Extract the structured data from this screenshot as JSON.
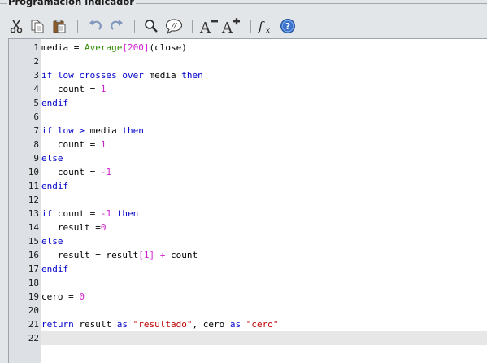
{
  "window": {
    "title": "Programación indicador"
  },
  "toolbar": {
    "buttons": [
      {
        "name": "cut-button",
        "icon": "scissors-icon"
      },
      {
        "name": "copy-button",
        "icon": "copy-icon"
      },
      {
        "name": "paste-button",
        "icon": "clipboard-icon"
      },
      {
        "name": "undo-button",
        "icon": "undo-icon"
      },
      {
        "name": "redo-button",
        "icon": "redo-icon"
      },
      {
        "name": "find-button",
        "icon": "magnifier-icon"
      },
      {
        "name": "comment-button",
        "icon": "comment-icon",
        "label": "//"
      },
      {
        "name": "decrease-font-button",
        "icon": "font-decrease-icon",
        "label": "A"
      },
      {
        "name": "increase-font-button",
        "icon": "font-increase-icon",
        "label": "A"
      },
      {
        "name": "insert-function-button",
        "icon": "function-icon",
        "label": "fx"
      },
      {
        "name": "help-button",
        "icon": "help-icon",
        "label": "?"
      }
    ]
  },
  "editor": {
    "current_line": 22,
    "lines": [
      {
        "n": "1",
        "tokens": [
          [
            "p",
            "media = "
          ],
          [
            "f",
            "Average"
          ],
          [
            "n",
            "[200]"
          ],
          [
            "p",
            "(close)"
          ]
        ]
      },
      {
        "n": "2",
        "tokens": []
      },
      {
        "n": "3",
        "tokens": [
          [
            "k",
            "if low crosses over"
          ],
          [
            "p",
            " media "
          ],
          [
            "k",
            "then"
          ]
        ]
      },
      {
        "n": "4",
        "tokens": [
          [
            "p",
            "   count = "
          ],
          [
            "n",
            "1"
          ]
        ]
      },
      {
        "n": "5",
        "tokens": [
          [
            "k",
            "endif"
          ]
        ]
      },
      {
        "n": "6",
        "tokens": []
      },
      {
        "n": "7",
        "tokens": [
          [
            "k",
            "if low > "
          ],
          [
            "p",
            "media "
          ],
          [
            "k",
            "then"
          ]
        ]
      },
      {
        "n": "8",
        "tokens": [
          [
            "p",
            "   count = "
          ],
          [
            "n",
            "1"
          ]
        ]
      },
      {
        "n": "9",
        "tokens": [
          [
            "k",
            "else"
          ]
        ]
      },
      {
        "n": "10",
        "tokens": [
          [
            "p",
            "   count = "
          ],
          [
            "n",
            "-1"
          ]
        ]
      },
      {
        "n": "11",
        "tokens": [
          [
            "k",
            "endif"
          ]
        ]
      },
      {
        "n": "12",
        "tokens": []
      },
      {
        "n": "13",
        "tokens": [
          [
            "k",
            "if"
          ],
          [
            "p",
            " count = "
          ],
          [
            "n",
            "-1 "
          ],
          [
            "k",
            "then"
          ]
        ]
      },
      {
        "n": "14",
        "tokens": [
          [
            "p",
            "   result ="
          ],
          [
            "n",
            "0"
          ]
        ]
      },
      {
        "n": "15",
        "tokens": [
          [
            "k",
            "else"
          ]
        ]
      },
      {
        "n": "16",
        "tokens": [
          [
            "p",
            "   result = result"
          ],
          [
            "n",
            "[1] + "
          ],
          [
            "p",
            "count"
          ]
        ]
      },
      {
        "n": "17",
        "tokens": [
          [
            "k",
            "endif"
          ]
        ]
      },
      {
        "n": "18",
        "tokens": []
      },
      {
        "n": "19",
        "tokens": [
          [
            "p",
            "cero = "
          ],
          [
            "n",
            "0"
          ]
        ]
      },
      {
        "n": "20",
        "tokens": []
      },
      {
        "n": "21",
        "tokens": [
          [
            "k",
            "return"
          ],
          [
            "p",
            " result "
          ],
          [
            "k",
            "as "
          ],
          [
            "s",
            "\"resultado\""
          ],
          [
            "p",
            ", cero "
          ],
          [
            "k",
            "as "
          ],
          [
            "s",
            "\"cero\""
          ]
        ]
      },
      {
        "n": "22",
        "tokens": []
      }
    ]
  }
}
